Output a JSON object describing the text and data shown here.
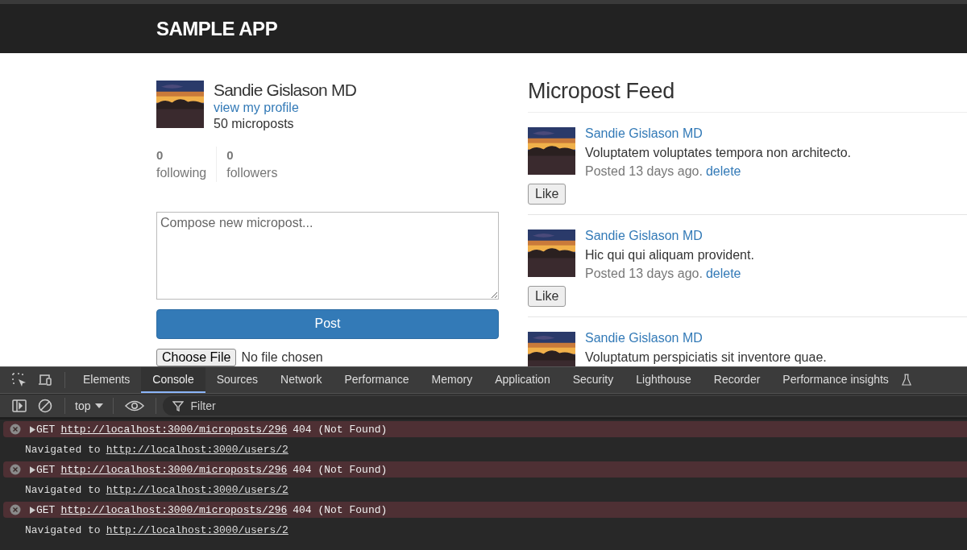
{
  "header": {
    "title": "SAMPLE APP"
  },
  "profile": {
    "name": "Sandie Gislason MD",
    "link": "view my profile",
    "count": "50 microposts"
  },
  "stats": [
    {
      "count": "0",
      "label": "following"
    },
    {
      "count": "0",
      "label": "followers"
    }
  ],
  "compose": {
    "placeholder": "Compose new micropost...",
    "button": "Post",
    "file_button": "Choose File",
    "file_status": "No file chosen"
  },
  "feed": {
    "title": "Micropost Feed",
    "posts": [
      {
        "author": "Sandie Gislason MD",
        "content": "Voluptatem voluptates tempora non architecto.",
        "timestamp": "Posted 13 days ago.",
        "delete": "delete",
        "like": "Like"
      },
      {
        "author": "Sandie Gislason MD",
        "content": "Hic qui qui aliquam provident.",
        "timestamp": "Posted 13 days ago.",
        "delete": "delete",
        "like": "Like"
      },
      {
        "author": "Sandie Gislason MD",
        "content": "Voluptatum perspiciatis sit inventore quae."
      }
    ]
  },
  "devtools": {
    "tabs": [
      {
        "label": "Elements",
        "selected": false
      },
      {
        "label": "Console",
        "selected": true
      },
      {
        "label": "Sources",
        "selected": false
      },
      {
        "label": "Network",
        "selected": false
      },
      {
        "label": "Performance",
        "selected": false
      },
      {
        "label": "Memory",
        "selected": false
      },
      {
        "label": "Application",
        "selected": false
      },
      {
        "label": "Security",
        "selected": false
      },
      {
        "label": "Lighthouse",
        "selected": false
      },
      {
        "label": "Recorder",
        "selected": false
      },
      {
        "label": "Performance insights",
        "selected": false
      }
    ],
    "context": "top",
    "filter_placeholder": "Filter",
    "console": [
      {
        "kind": "error",
        "method": "GET",
        "url": "http://localhost:3000/microposts/296",
        "status": "404 (Not Found)"
      },
      {
        "kind": "log",
        "text": "Navigated to",
        "url": "http://localhost:3000/users/2"
      },
      {
        "kind": "error",
        "method": "GET",
        "url": "http://localhost:3000/microposts/296",
        "status": "404 (Not Found)"
      },
      {
        "kind": "log",
        "text": "Navigated to",
        "url": "http://localhost:3000/users/2"
      },
      {
        "kind": "error",
        "method": "GET",
        "url": "http://localhost:3000/microposts/296",
        "status": "404 (Not Found)"
      },
      {
        "kind": "log",
        "text": "Navigated to",
        "url": "http://localhost:3000/users/2"
      }
    ]
  }
}
